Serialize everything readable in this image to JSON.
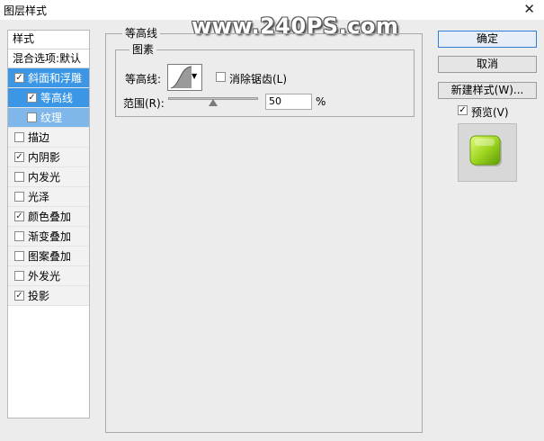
{
  "window": {
    "title": "图层样式",
    "close_glyph": "✕"
  },
  "watermark": "www.240PS.com",
  "styles_panel": {
    "header": "样式",
    "blending": "混合选项:默认",
    "items": [
      {
        "label": "斜面和浮雕",
        "checked": true,
        "selected": true,
        "sub": false
      },
      {
        "label": "等高线",
        "checked": true,
        "selected": true,
        "sub": true
      },
      {
        "label": "纹理",
        "checked": false,
        "selected": false,
        "sub": true
      },
      {
        "label": "描边",
        "checked": false,
        "selected": false,
        "sub": false
      },
      {
        "label": "内阴影",
        "checked": true,
        "selected": false,
        "sub": false
      },
      {
        "label": "内发光",
        "checked": false,
        "selected": false,
        "sub": false
      },
      {
        "label": "光泽",
        "checked": false,
        "selected": false,
        "sub": false
      },
      {
        "label": "颜色叠加",
        "checked": true,
        "selected": false,
        "sub": false
      },
      {
        "label": "渐变叠加",
        "checked": false,
        "selected": false,
        "sub": false
      },
      {
        "label": "图案叠加",
        "checked": false,
        "selected": false,
        "sub": false
      },
      {
        "label": "外发光",
        "checked": false,
        "selected": false,
        "sub": false
      },
      {
        "label": "投影",
        "checked": true,
        "selected": false,
        "sub": false
      }
    ]
  },
  "contour_section": {
    "group_title": "等高线",
    "sub_group_title": "图素",
    "contour_label": "等高线:",
    "anti_alias_label": "消除锯齿(L)",
    "anti_alias_checked": false,
    "range_label": "范围(R):",
    "range_value": "50",
    "range_unit": "%",
    "range_percent": 50
  },
  "buttons": {
    "ok": "确定",
    "cancel": "取消",
    "new_style": "新建样式(W)...",
    "preview_label": "预览(V)",
    "preview_checked": true
  },
  "colors": {
    "selection": "#3c96e6",
    "sub_selection": "#7fb7ea",
    "preview_swatch": "#9ad21c"
  }
}
